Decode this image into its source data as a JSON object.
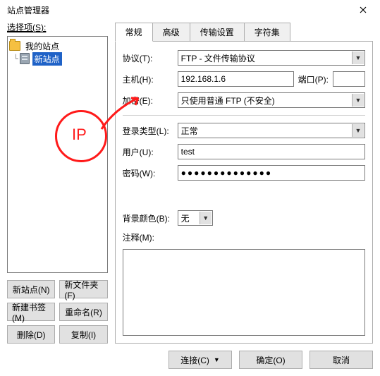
{
  "window": {
    "title": "站点管理器"
  },
  "left": {
    "select_label": "选择项(S):",
    "tree": {
      "root_label": "我的站点",
      "site_label": "新站点"
    },
    "buttons": {
      "new_site": "新站点(N)",
      "new_folder": "新文件夹(F)",
      "new_bookmark": "新建书签(M)",
      "rename": "重命名(R)",
      "delete": "删除(D)",
      "copy": "复制(I)"
    }
  },
  "tabs": {
    "general": "常规",
    "advanced": "高级",
    "transfer": "传输设置",
    "charset": "字符集"
  },
  "form": {
    "protocol_label": "协议(T):",
    "protocol_value": "FTP - 文件传输协议",
    "host_label": "主机(H):",
    "host_value": "192.168.1.6",
    "port_label": "端口(P):",
    "port_value": "",
    "encryption_label": "加密(E):",
    "encryption_value": "只使用普通 FTP (不安全)",
    "logon_label": "登录类型(L):",
    "logon_value": "正常",
    "user_label": "用户(U):",
    "user_value": "test",
    "password_label": "密码(W):",
    "password_value": "●●●●●●●●●●●●●●",
    "bgcolor_label": "背景颜色(B):",
    "bgcolor_value": "无",
    "comment_label": "注释(M):"
  },
  "footer": {
    "connect": "连接(C)",
    "ok": "确定(O)",
    "cancel": "取消"
  },
  "annotation": {
    "text": "IP"
  }
}
